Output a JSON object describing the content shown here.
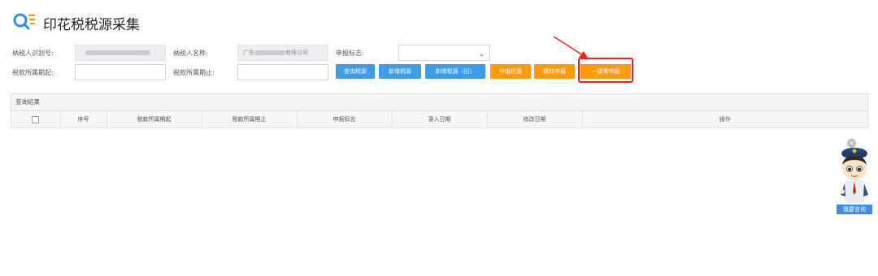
{
  "page": {
    "title": "印花税税源采集",
    "title_icon": "search-icon"
  },
  "form": {
    "taxpayer_id": {
      "label": "纳税人识别号:",
      "value": ""
    },
    "taxpayer_name": {
      "label": "纳税人名称:",
      "value_prefix": "广东",
      "value_suffix": "有限公司"
    },
    "declare_flag": {
      "label": "申报标志:",
      "value": ""
    },
    "period_start": {
      "label": "税款所属期起:",
      "value": ""
    },
    "period_end": {
      "label": "税款所属期止:",
      "value": ""
    }
  },
  "buttons": {
    "query": "查询税源",
    "add": "新增税源",
    "add_old": "新增税源（旧）",
    "void": "作废税源",
    "jump": "跳转申报",
    "one_click_zero": "一键零申报"
  },
  "results": {
    "header": "查询结果",
    "columns": [
      "序号",
      "税款所属期起",
      "税款所属期止",
      "申报标志",
      "录入日期",
      "修改日期",
      "操作"
    ]
  },
  "assistant": {
    "label": "我要咨询"
  },
  "colors": {
    "primary_blue": "#3d9ce8",
    "orange": "#ff9a0d",
    "highlight_red": "#e22222"
  }
}
